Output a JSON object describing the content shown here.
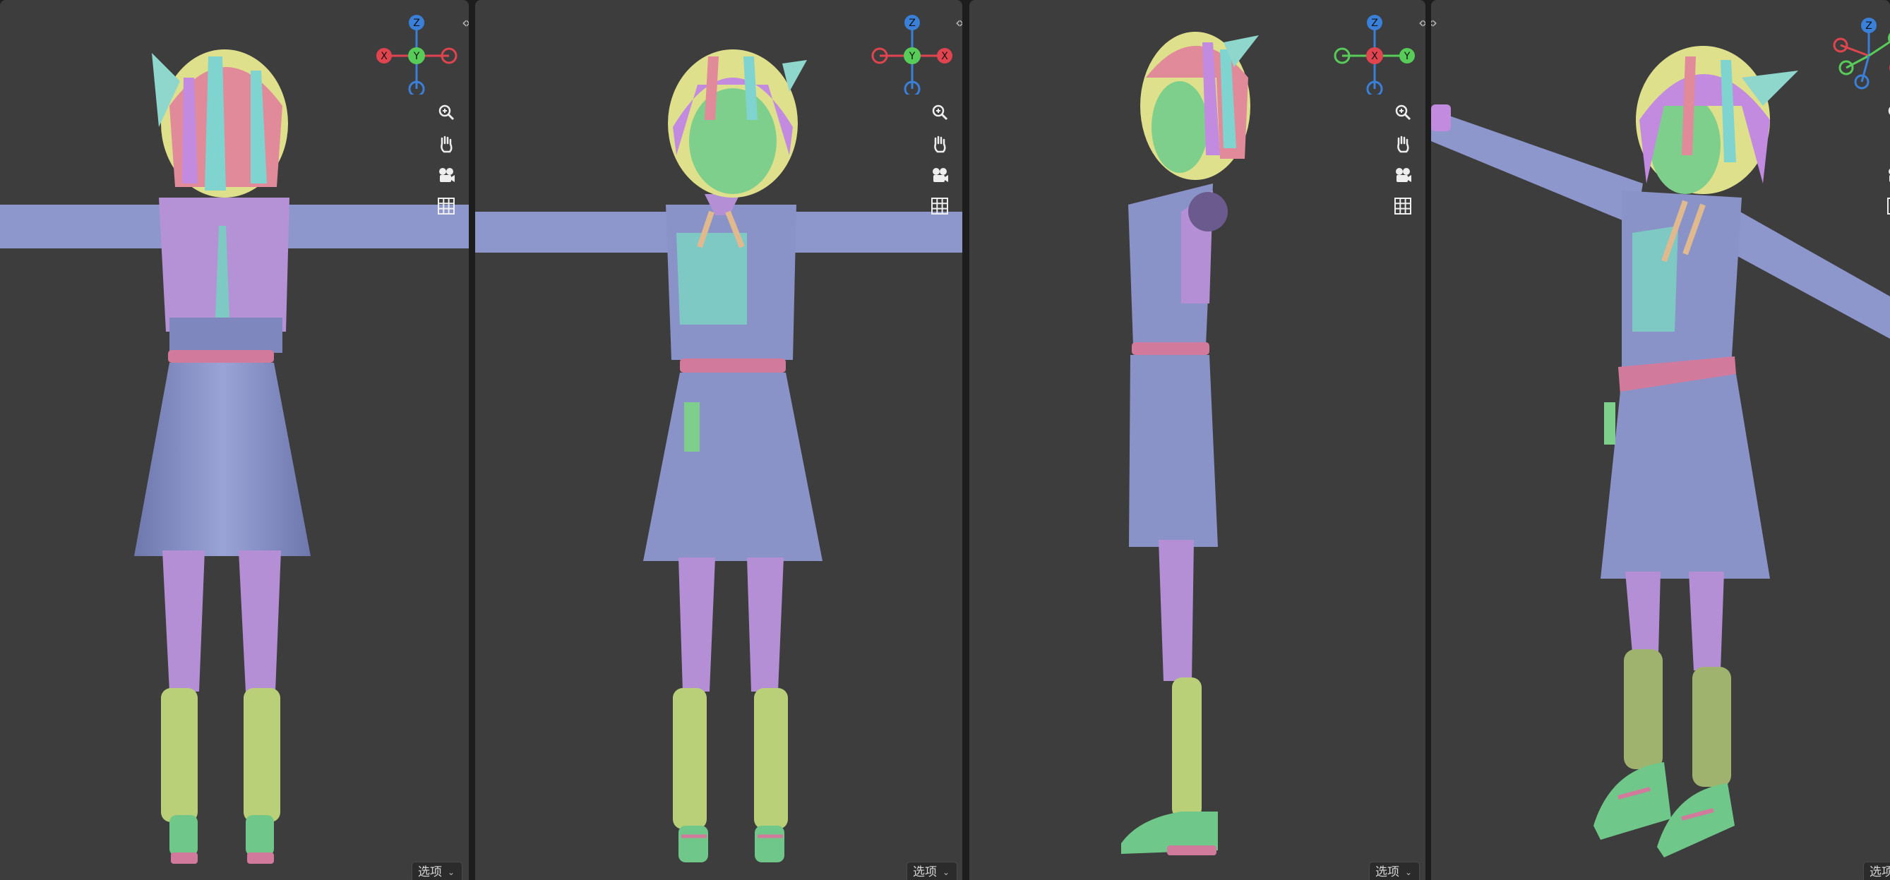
{
  "colors": {
    "background": "#3d3d3d",
    "separator": "#1d1d1d",
    "axis_x": "#e0454f",
    "axis_y": "#58cc59",
    "axis_z": "#3a7fd8",
    "cloth": "#8a93c8",
    "vest": "#b58fd6",
    "skin": "#7fcf8c",
    "socks": "#b9cf78",
    "belt": "#d27a9c",
    "hair_pink": "#e08a9a",
    "hair_yellow": "#dfe08c",
    "hair_cyan": "#7fd4cf",
    "hair_purple": "#c28be0"
  },
  "viewports": [
    {
      "view": "back",
      "gizmo": {
        "center": "Y",
        "left": "X",
        "right": "",
        "top": "Z",
        "bottom": ""
      },
      "tools": [
        "zoom-icon",
        "pan-hand-icon",
        "camera-icon",
        "grid-icon"
      ],
      "options_label": "选项"
    },
    {
      "view": "front",
      "gizmo": {
        "center": "Y",
        "left": "",
        "right": "X",
        "top": "Z",
        "bottom": ""
      },
      "tools": [
        "zoom-icon",
        "pan-hand-icon",
        "camera-icon",
        "grid-icon"
      ],
      "options_label": "选项"
    },
    {
      "view": "side",
      "gizmo": {
        "center": "X",
        "left": "",
        "right": "Y",
        "top": "Z",
        "bottom": ""
      },
      "tools": [
        "zoom-icon",
        "pan-hand-icon",
        "camera-icon",
        "grid-icon"
      ],
      "options_label": "选项"
    },
    {
      "view": "perspective",
      "gizmo": {
        "center": "",
        "left": "",
        "right": "Y",
        "top": "Z",
        "bottom": ""
      },
      "tools": [
        "zoom-icon",
        "pan-hand-icon",
        "camera-icon",
        "grid-icon"
      ],
      "options_label": "选项"
    }
  ]
}
